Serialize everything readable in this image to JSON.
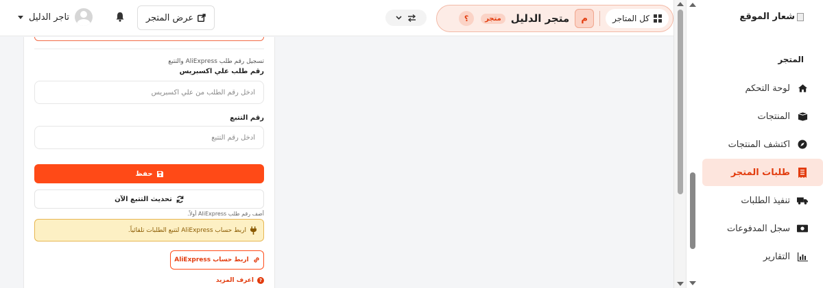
{
  "sidebar": {
    "logo_text": "شعار الموقع",
    "section_title": "المتجر",
    "items": [
      {
        "label": "لوحة التحكم",
        "icon": "home-icon"
      },
      {
        "label": "المنتجات",
        "icon": "box-icon"
      },
      {
        "label": "اكتشف المنتجات",
        "icon": "compass-icon"
      },
      {
        "label": "طلبات المتجر",
        "icon": "receipt-icon",
        "active": true
      },
      {
        "label": "تنفيذ الطلبات",
        "icon": "truck-icon"
      },
      {
        "label": "سجل المدفوعات",
        "icon": "money-icon"
      },
      {
        "label": "التقارير",
        "icon": "chart-icon"
      }
    ]
  },
  "topbar": {
    "all_stores": "كل المتاجر",
    "store_avatar": "م",
    "store_name": "متجر الدليل",
    "store_badge": "متجر",
    "help": "؟",
    "view_store": "عرض المتجر",
    "user_name": "تاجر الدليل"
  },
  "form": {
    "caption": "تسجيل رقم طلب AliExpress والتتبع",
    "order_label": "رقم طلب علي اكسبريس",
    "order_placeholder": "أدخل رقم الطلب من علي اكسبريس",
    "tracking_label": "رقم التتبع",
    "tracking_placeholder": "أدخل رقم التتبع",
    "save_label": "حفظ",
    "refresh_label": "تحديث التتبع الآن",
    "hint": "أضف رقم طلب AliExpress أولاً.",
    "alert_text": "اربط حساب AliExpress لتتبع الطلبات تلقائياً.",
    "link_button": "اربط حساب AliExpress",
    "learn_more": "اعرف المزيد"
  },
  "colors": {
    "accent": "#ff4a17",
    "accent_soft": "#fde5dd",
    "warning_bg": "#fdf0c4",
    "warning_border": "#e7b650"
  }
}
